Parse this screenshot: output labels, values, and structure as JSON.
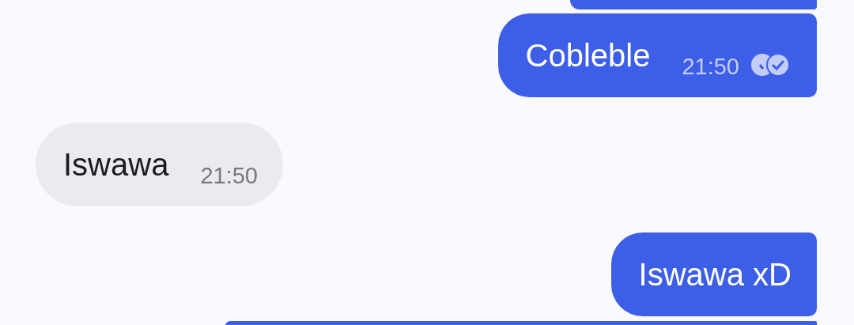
{
  "messages": [
    {
      "outgoing": true,
      "kind": "clipped_top"
    },
    {
      "outgoing": true,
      "kind": "text",
      "text": "Cobleble",
      "time": "21:50",
      "read": true
    },
    {
      "outgoing": false,
      "kind": "text",
      "text": "Iswawa",
      "time": "21:50"
    },
    {
      "outgoing": true,
      "kind": "text",
      "text": "Iswawa xD"
    },
    {
      "outgoing": true,
      "kind": "clipped_bottom"
    }
  ]
}
